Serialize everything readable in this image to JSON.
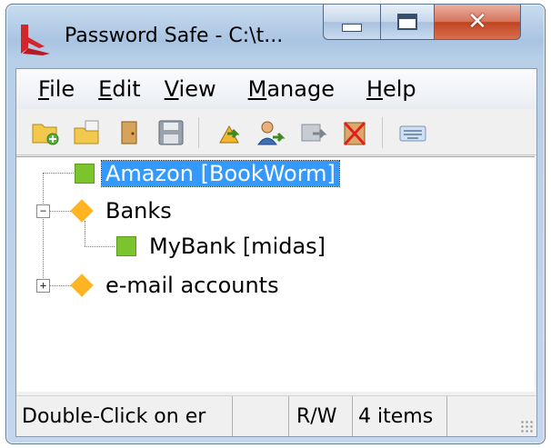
{
  "window": {
    "title": "Password Safe - C:\\t..."
  },
  "menu": [
    {
      "accel": "F",
      "rest": "ile"
    },
    {
      "accel": "E",
      "rest": "dit"
    },
    {
      "accel": "V",
      "rest": "iew"
    },
    {
      "accel": "M",
      "rest": "anage"
    },
    {
      "accel": "H",
      "rest": "elp"
    }
  ],
  "toolbar_icons": [
    "new-db-icon",
    "open-db-icon",
    "close-db-icon",
    "save-icon",
    "add-entry-icon",
    "edit-entry-icon",
    "copy-entry-icon",
    "delete-entry-icon",
    "keyboard-icon"
  ],
  "tree": {
    "entry_amazon": "Amazon [BookWorm]",
    "group_banks": "Banks",
    "entry_mybank": "MyBank [midas]",
    "group_email": "e-mail accounts"
  },
  "status": {
    "hint": "Double-Click on er",
    "mode": "R/W",
    "count": "4 items"
  },
  "colors": {
    "selection": "#3399ff",
    "entry": "#7cc42e",
    "group": "#ffb521"
  }
}
